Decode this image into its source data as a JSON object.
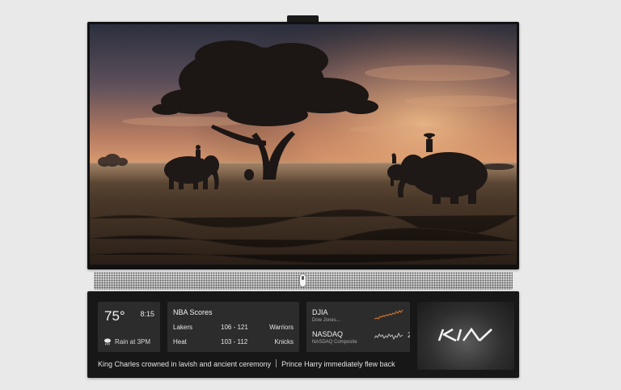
{
  "weather": {
    "temperature": "75°",
    "time": "8:15",
    "forecast_icon": "rain-cloud-icon",
    "forecast": "Rain at 3PM"
  },
  "nba": {
    "title": "NBA Scores",
    "games": [
      {
        "team1": "Lakers",
        "score": "106 - 121",
        "team2": "Warriors"
      },
      {
        "team1": "Heat",
        "score": "103 - 112",
        "team2": "Knicks"
      }
    ]
  },
  "stocks": {
    "items": [
      {
        "symbol": "DJIA",
        "subtitle": "Dow Jones...",
        "trend_color": "#e07a2e"
      },
      {
        "symbol": "NASDAQ",
        "subtitle": "NASDAQ Composite",
        "trend_color": "#bdbdbd"
      }
    ],
    "next_peek": "2"
  },
  "ad": {
    "brand": "KIA"
  },
  "ticker": {
    "headlines": [
      "King Charles crowned in lavish and ancient ceremony",
      "Prince Harry immediately flew back"
    ]
  },
  "colors": {
    "panel_bg": "#171717",
    "widget_bg": "#2c2c2c",
    "djia_line": "#e07a2e",
    "nasdaq_line": "#bdbdbd"
  }
}
